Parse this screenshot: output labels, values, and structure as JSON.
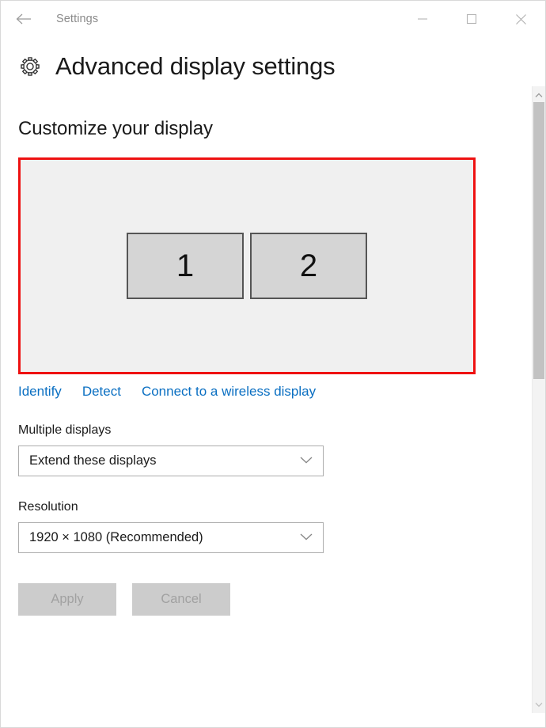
{
  "window": {
    "titlebar": {
      "back_icon": "back-arrow-icon",
      "title": "Settings",
      "minimize_icon": "minimize-icon",
      "maximize_icon": "maximize-icon",
      "close_icon": "close-icon"
    },
    "header": {
      "icon": "gear-icon",
      "title": "Advanced display settings"
    }
  },
  "main": {
    "section_title": "Customize your display",
    "display_preview": {
      "highlight_color": "#ee1111",
      "background_color": "#f0f0f0",
      "monitors": [
        {
          "label": "1"
        },
        {
          "label": "2"
        }
      ]
    },
    "links": [
      {
        "label": "Identify",
        "name": "identify-link"
      },
      {
        "label": "Detect",
        "name": "detect-link"
      },
      {
        "label": "Connect to a wireless display",
        "name": "connect-wireless-display-link"
      }
    ],
    "link_color": "#0a6fc2",
    "multiple_displays": {
      "label": "Multiple displays",
      "value": "Extend these displays",
      "chevron_icon": "chevron-down-icon"
    },
    "resolution": {
      "label": "Resolution",
      "value": "1920 × 1080 (Recommended)",
      "chevron_icon": "chevron-down-icon"
    },
    "buttons": {
      "apply": "Apply",
      "cancel": "Cancel",
      "disabled_bg": "#cccccc",
      "disabled_text": "#a1a1a1"
    }
  },
  "scrollbar": {
    "up_icon": "chevron-up-icon",
    "down_icon": "chevron-down-icon"
  }
}
